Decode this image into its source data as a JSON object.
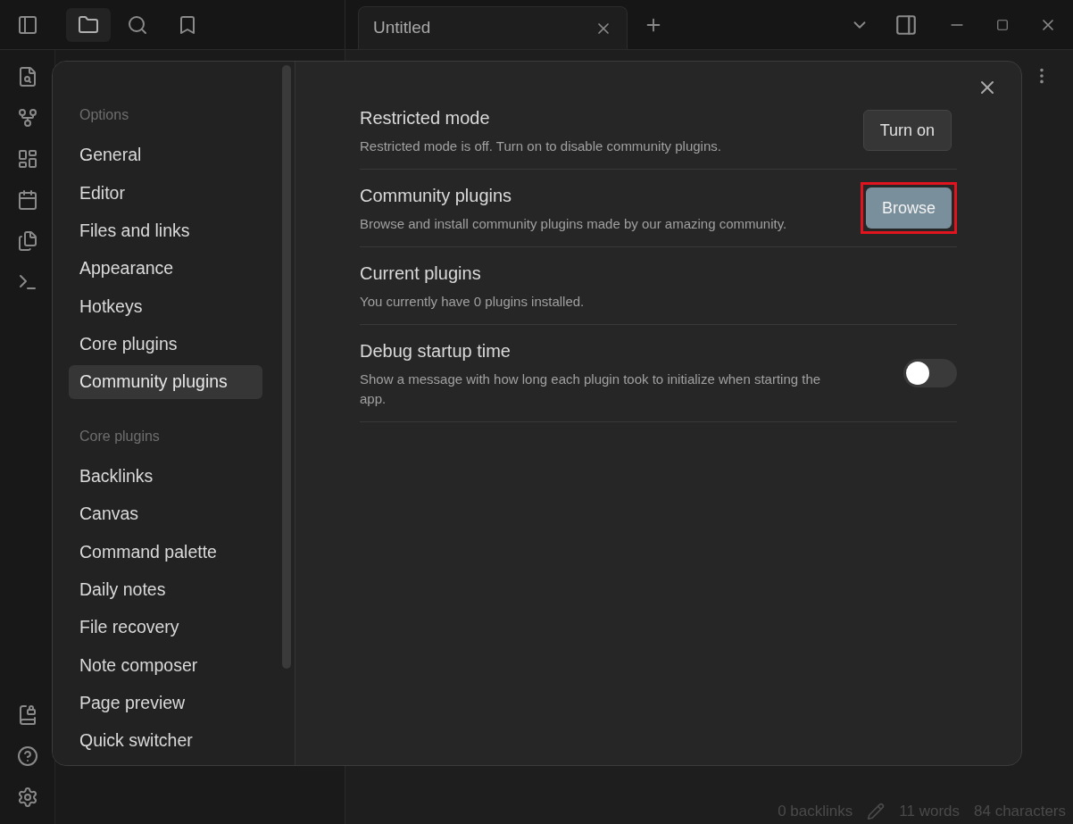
{
  "tab_bar": {
    "tabs": [
      {
        "title": "Untitled",
        "selected": true
      }
    ]
  },
  "settings_nav": {
    "sections": [
      {
        "heading": "Options",
        "items": [
          {
            "label": "General",
            "selected": false
          },
          {
            "label": "Editor",
            "selected": false
          },
          {
            "label": "Files and links",
            "selected": false
          },
          {
            "label": "Appearance",
            "selected": false
          },
          {
            "label": "Hotkeys",
            "selected": false
          },
          {
            "label": "Core plugins",
            "selected": false
          },
          {
            "label": "Community plugins",
            "selected": true
          }
        ]
      },
      {
        "heading": "Core plugins",
        "items": [
          {
            "label": "Backlinks",
            "selected": false
          },
          {
            "label": "Canvas",
            "selected": false
          },
          {
            "label": "Command palette",
            "selected": false
          },
          {
            "label": "Daily notes",
            "selected": false
          },
          {
            "label": "File recovery",
            "selected": false
          },
          {
            "label": "Note composer",
            "selected": false
          },
          {
            "label": "Page preview",
            "selected": false
          },
          {
            "label": "Quick switcher",
            "selected": false
          }
        ]
      }
    ]
  },
  "settings": [
    {
      "kind": "button",
      "title": "Restricted mode",
      "description": "Restricted mode is off. Turn on to disable community plugins.",
      "button": "Turn on",
      "accent": false,
      "highlighted": false
    },
    {
      "kind": "button",
      "title": "Community plugins",
      "description": "Browse and install community plugins made by our amazing community.",
      "button": "Browse",
      "accent": true,
      "highlighted": true
    },
    {
      "kind": "info",
      "title": "Current plugins",
      "description": "You currently have 0 plugins installed."
    },
    {
      "kind": "toggle",
      "title": "Debug startup time",
      "description": "Show a message with how long each plugin took to initialize when starting the app.",
      "on": false
    }
  ],
  "status_bar": {
    "backlinks": "0 backlinks",
    "words": "11 words",
    "characters": "84 characters"
  }
}
